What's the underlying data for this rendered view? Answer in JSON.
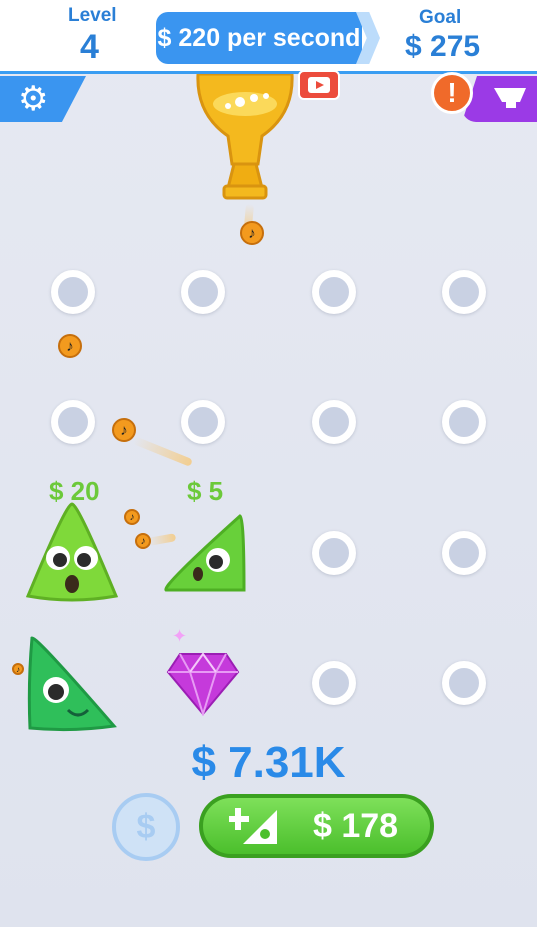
{
  "hud": {
    "level_label": "Level",
    "level_value": "4",
    "rate_text": "$ 220 per second",
    "goal_label": "Goal",
    "goal_value": "$ 275"
  },
  "buttons": {
    "settings_icon": "gear-icon",
    "shop_icon": "shop-icon",
    "alert_text": "!",
    "video_icon": "video-icon"
  },
  "board": {
    "tags": [
      "$ 20",
      "$ 5"
    ]
  },
  "footer": {
    "total": "$ 7.31K",
    "swap_icon": "$",
    "buy_price": "$ 178"
  },
  "colors": {
    "accent": "#3a95f0",
    "money_green": "#6cc93a",
    "buy_green": "#4bbf2c",
    "shop_purple": "#9b3ae6",
    "alert_orange": "#f06a2a"
  }
}
